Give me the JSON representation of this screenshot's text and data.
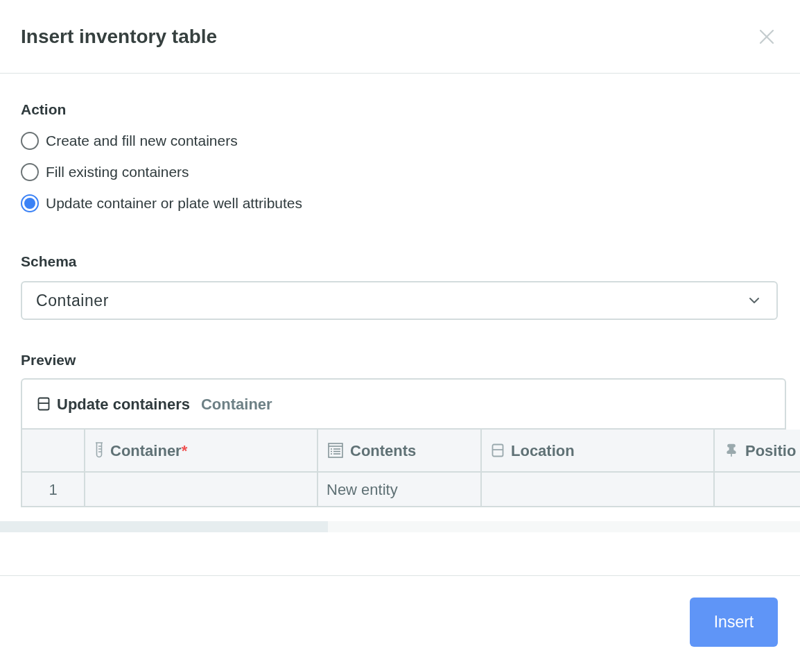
{
  "dialog": {
    "title": "Insert inventory table"
  },
  "action": {
    "label": "Action",
    "options": [
      {
        "label": "Create and fill new containers",
        "selected": false
      },
      {
        "label": "Fill existing containers",
        "selected": false
      },
      {
        "label": "Update container or plate well attributes",
        "selected": true
      }
    ]
  },
  "schema": {
    "label": "Schema",
    "value": "Container"
  },
  "preview": {
    "label": "Preview",
    "table_title": "Update containers",
    "table_subtitle": "Container",
    "columns": [
      {
        "kind": "index"
      },
      {
        "kind": "tube",
        "label": "Container",
        "required_mark": "*"
      },
      {
        "kind": "list",
        "label": "Contents"
      },
      {
        "kind": "box",
        "label": "Location"
      },
      {
        "kind": "pin",
        "label": "Positio"
      }
    ],
    "rows": [
      [
        "1",
        "",
        "New entity",
        "",
        ""
      ]
    ]
  },
  "footer": {
    "button": "Insert"
  }
}
